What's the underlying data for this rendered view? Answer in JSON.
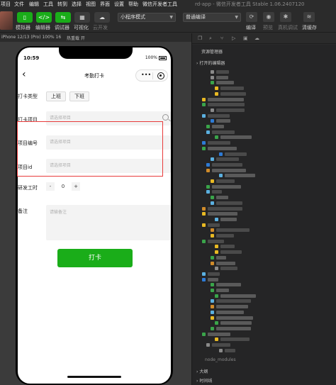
{
  "menubar": {
    "items": [
      "项目",
      "文件",
      "编辑",
      "工具",
      "转到",
      "选择",
      "视图",
      "界面",
      "设置",
      "帮助",
      "微信开发者工具"
    ],
    "window_title": "rd-app - 微信开发者工具 Stable 1.06.2407120"
  },
  "toolbar": {
    "simulator": "模拟器",
    "editor": "编辑器",
    "debugger": "调试器",
    "visual": "可视化",
    "cloud": "云开发",
    "mode_select": "小程序模式",
    "compile_select": "普通编译",
    "compile": "编译",
    "preview": "预览",
    "real_debug": "真机调试",
    "clear_cache": "清缓存"
  },
  "simulator_header": {
    "device": "iPhone 12/13 (Pro) 100% 16",
    "hotreload": "热重载 开"
  },
  "phone": {
    "time": "10:59",
    "battery": "100%",
    "nav_title": "考勤打卡",
    "form": {
      "punch_type_label": "打卡类型",
      "punch_in": "上班",
      "punch_out": "下班",
      "project_label": "打卡项目",
      "project_placeholder": "请选择项目",
      "project_no_label": "项目编号",
      "project_no_placeholder": "请选择项目",
      "project_id_label": "项目id",
      "project_id_placeholder": "请选择项目",
      "dev_hours_label": "研发工时",
      "minus": "-",
      "hours_value": "0",
      "plus": "+",
      "remark_label": "备注",
      "remark_placeholder": "请输备注",
      "submit": "打卡"
    }
  },
  "explorer": {
    "title": "资源管理器",
    "open_editors": "打开的编辑器",
    "node_modules": "node_modules",
    "outline": "大纲",
    "timeline": "时间线"
  },
  "colors": {
    "accent_green": "#1aad19",
    "highlight_red": "#e83b3b"
  }
}
